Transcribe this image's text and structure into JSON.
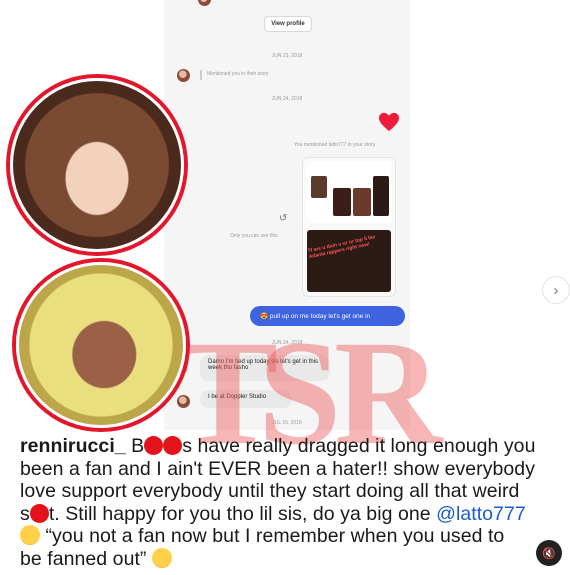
{
  "dm": {
    "view_profile": "View profile",
    "date1": "JUN 23, 2018",
    "mention_text": "Mentioned you in their story",
    "date2": "JUN 24, 2018",
    "mention_reply": "You mentioned latto777 in your story",
    "only_you": "Only you can see this",
    "story_overlay": "Tf are u doin u ur ur top 5 fav Atlanta rappers right now!",
    "outgoing_msg": "😍 pull up on me today let's get one in",
    "date3": "JUN 24, 2018",
    "incoming_1": "Damn I'm tied up today sis let's get in this week tho fasho",
    "incoming_2": "I be at Doppler Studio",
    "date4": "JUL 15, 2018"
  },
  "caption": {
    "username": "rennirucci_",
    "line1_rest": "s have really dragged it long enough you",
    "b_start": "B",
    "line2": "been a fan and I ain't EVER been a hater!! show everybody",
    "line3": "love support everybody until they start doing all that weird",
    "line4_start": "s",
    "line4_rest": "t. Still happy for you tho lil sis, do ya big one",
    "mention": "@latto777",
    "line5": "“you not a fan now but I remember when you used to",
    "line6": "be fanned out”"
  },
  "watermark": "TSR",
  "colors": {
    "accent_red": "#e3162b",
    "bubble_blue": "#3d63e0",
    "heart": "#ee1c3b",
    "mention_blue": "#1d5bd1"
  },
  "icons": {
    "nav": "chevron-right-icon",
    "mute": "speaker-muted-icon",
    "heart": "heart-icon"
  }
}
